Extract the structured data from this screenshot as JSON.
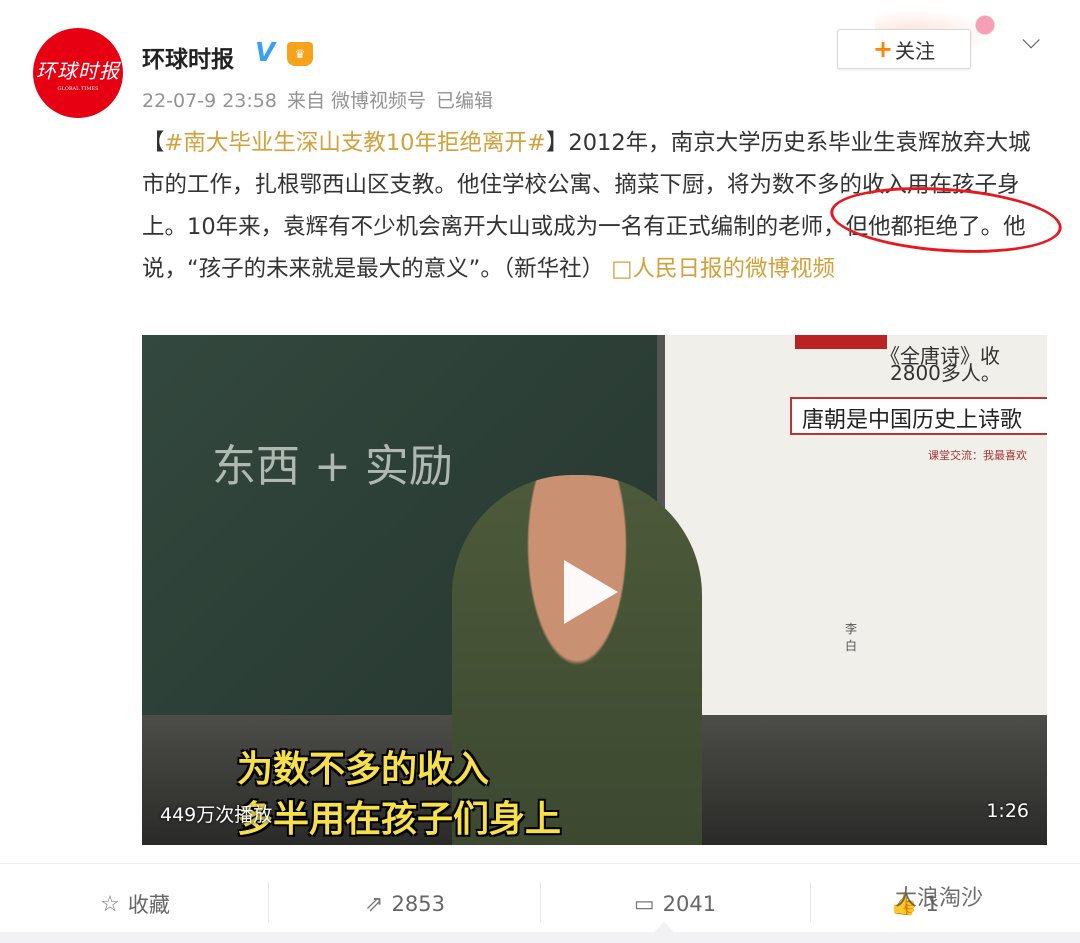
{
  "post": {
    "avatar_text": "环球时报",
    "avatar_sub": "GLOBAL TIMES",
    "author": "环球时报",
    "verified": "V",
    "timestamp": "22-07-9 23:58",
    "source": "来自 微博视频号",
    "edited": "已编辑",
    "follow_label": "关注",
    "follow_plus": "+",
    "bracket_open": "【",
    "hashtag": "#南大毕业生深山支教10年拒绝离开#",
    "bracket_close": "】",
    "body": "2012年，南京大学历史系毕业生袁辉放弃大城市的工作，扎根鄂西山区支教。他住学校公寓、摘菜下厨，将为数不多的收入用在孩子身上。10年来，袁辉有不少机会离开大山或成为一名有正式编制的老师，但他都拒绝了。他说，“孩子的未来就是最大的意义”。（新华社）",
    "link_icon": "□",
    "link_text": "人民日报的微博视频"
  },
  "video": {
    "chalk1": "东西 + 实励",
    "slide_line1": "《全唐诗》收",
    "slide_line2": "2800多人。",
    "slide_box": "唐朝是中国历史上诗歌",
    "slide_small": "课堂交流：我最喜欢",
    "slide_name": "李白",
    "subtitle1": "为数不多的收入",
    "subtitle2": "多半用在孩子们身上",
    "views": "449万次播放",
    "duration": "1:26"
  },
  "actions": {
    "favorite": "收藏",
    "repost": "2853",
    "comment": "2041",
    "like": "1",
    "watermark": "大浪淘沙"
  }
}
